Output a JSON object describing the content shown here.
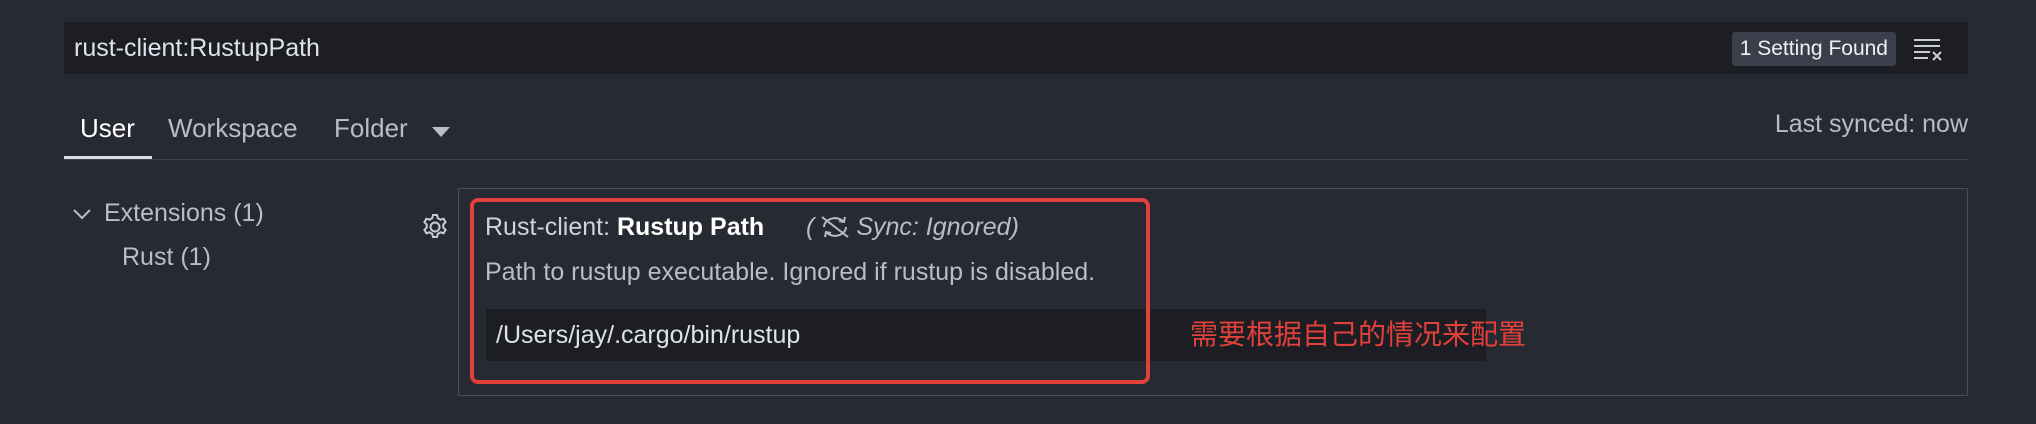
{
  "search": {
    "value": "rust-client:RustupPath",
    "result_count": "1 Setting Found"
  },
  "tabs": [
    {
      "label": "User",
      "active": true
    },
    {
      "label": "Workspace",
      "active": false
    },
    {
      "label": "Folder",
      "active": false
    }
  ],
  "last_synced": "Last synced: now",
  "tree": {
    "group_label": "Extensions (1)",
    "item_label": "Rust (1)"
  },
  "setting": {
    "title_prefix": "Rust-client: ",
    "title_name": "Rustup Path",
    "sync_open": "(",
    "sync_text": "Sync: Ignored)",
    "description": "Path to rustup executable. Ignored if rustup is disabled.",
    "value": "/Users/jay/.cargo/bin/rustup"
  },
  "annotation": {
    "note": "需要根据自己的情况来配置",
    "color": "#e2403a"
  },
  "colors": {
    "background": "#272a33",
    "input_background": "#1c1e24"
  }
}
